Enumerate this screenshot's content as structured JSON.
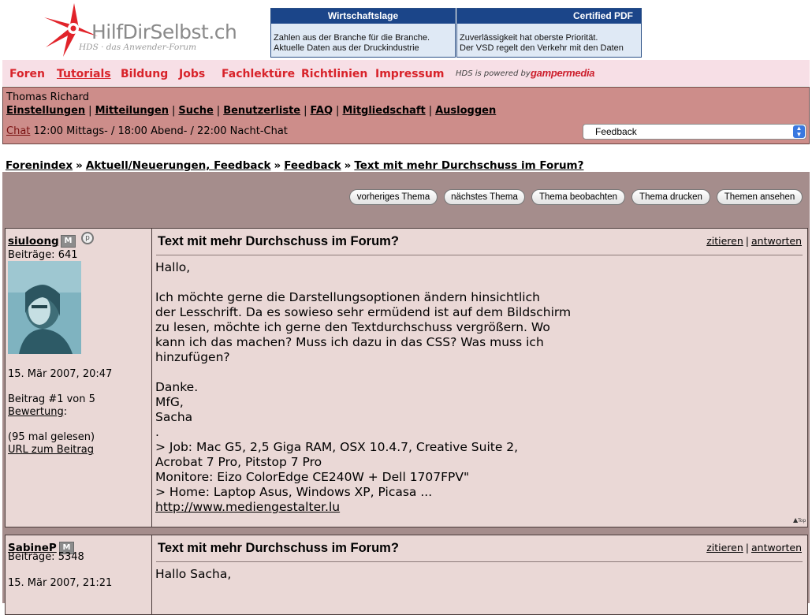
{
  "header": {
    "logo_text": "HilfDirSelbst.ch",
    "logo_subtitle": "HDS · das Anwender-Forum",
    "ads": [
      {
        "title": "Wirtschaftslage",
        "line1": "Zahlen aus der Branche für die Branche.",
        "line2": "Aktuelle Daten aus der Druckindustrie"
      },
      {
        "title": "Certified PDF",
        "line1": "Zuverlässigkeit hat oberste Priorität.",
        "line2": "Der VSD regelt den Verkehr mit den Daten"
      }
    ]
  },
  "nav": {
    "items": [
      "Foren",
      "Tutorials",
      "Bildung",
      "Jobs",
      "Fachlektüre",
      "Richtlinien",
      "Impressum"
    ],
    "powered": "HDS  is  powered  by",
    "sponsor": "gampermedia"
  },
  "user_panel": {
    "username": "Thomas Richard",
    "links": [
      "Einstellungen",
      "Mitteilungen",
      "Suche",
      "Benutzerliste",
      "FAQ",
      "Mitgliedschaft",
      "Ausloggen"
    ],
    "chat_label": "Chat",
    "chat_times": "12:00 Mittags- / 18:00 Abend- / 22:00 Nacht-Chat",
    "forum_select": "Feedback"
  },
  "breadcrumb": [
    "Forenindex",
    "Aktuell/Neuerungen, Feedback",
    "Feedback",
    "Text mit mehr Durchschuss im Forum?"
  ],
  "thread_buttons": [
    "vorheriges Thema",
    "nächstes Thema",
    "Thema beobachten",
    "Thema drucken",
    "Themen ansehen"
  ],
  "posts": [
    {
      "author": "siuloong",
      "badge": "M",
      "posts_count": "Beiträge: 641",
      "date": "15. Mär 2007, 20:47",
      "post_number": "Beitrag #1 von 5",
      "rating_label": "Bewertung",
      "read_count": "(95 mal gelesen)",
      "url_link": "URL zum Beitrag",
      "title": "Text mit mehr Durchschuss im Forum?",
      "quote": "zitieren",
      "reply": "antworten",
      "body": "Hallo,\n\nIch möchte gerne die Darstellungsoptionen ändern hinsichtlich\nder Lesschrift. Da es sowieso sehr ermüdend ist auf dem Bildschirm\nzu lesen, möchte ich gerne den Textdurchschuss vergrößern. Wo\nkann ich das machen? Muss ich dazu in das CSS? Was muss ich\nhinzufügen?\n\nDanke.\nMfG,\nSacha\n.\n> Job: Mac G5, 2,5 Giga RAM, OSX 10.4.7, Creative Suite 2,\nAcrobat 7 Pro, Pitstop 7 Pro\nMonitore: Eizo ColorEdge CE240W + Dell 1707FPV\"\n> Home: Laptop Asus, Windows XP, Picasa ...",
      "signature_link": "http://www.mediengestalter.lu"
    },
    {
      "author": "SabineP",
      "badge": "M",
      "posts_count": "Beiträge: 5348",
      "date": "15. Mär 2007, 21:21",
      "title": "Text mit mehr Durchschuss im Forum?",
      "quote": "zitieren",
      "reply": "antworten",
      "body": "Hallo Sacha,"
    }
  ]
}
